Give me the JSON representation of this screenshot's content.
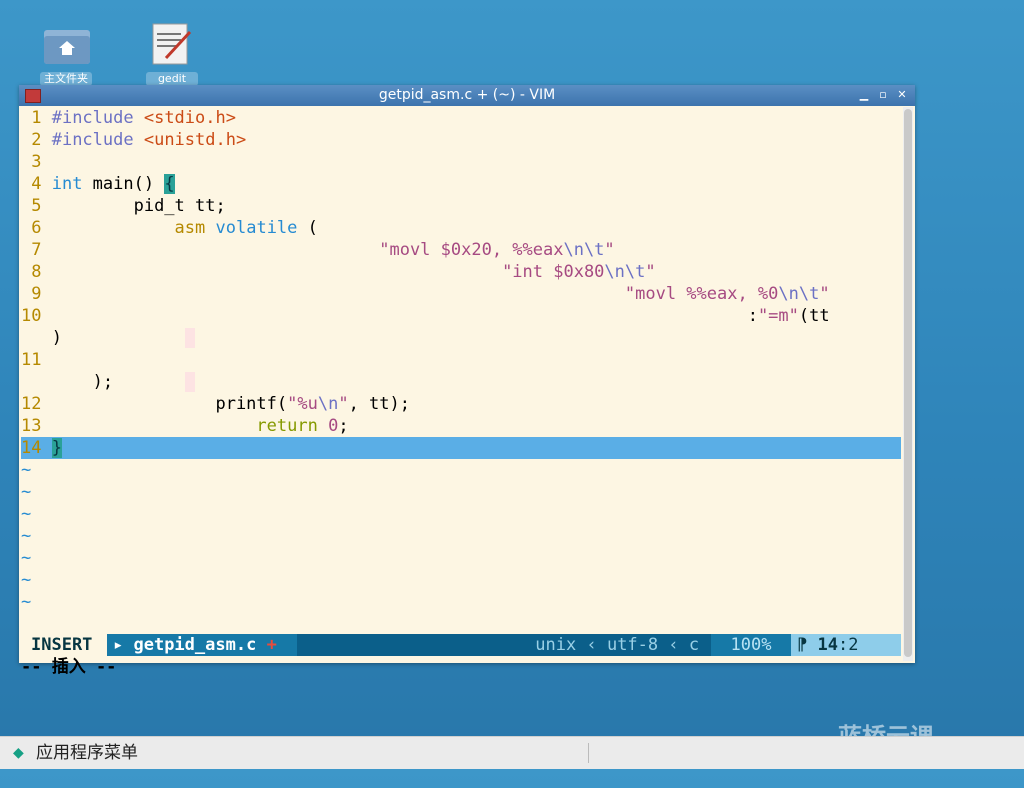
{
  "desktop": {
    "icons": [
      {
        "label": "主文件夹",
        "icon": "home-folder-icon"
      },
      {
        "label": "gedit",
        "icon": "text-editor-icon"
      }
    ],
    "watermark": "蓝桥云课"
  },
  "window": {
    "title": "getpid_asm.c + (~) - VIM",
    "buttons": {
      "minimize": "▁",
      "maximize": "▫",
      "close": "✕"
    }
  },
  "code": {
    "lines": [
      {
        "n": "1",
        "text": "#include <stdio.h>"
      },
      {
        "n": "2",
        "text": "#include <unistd.h>"
      },
      {
        "n": "3",
        "text": ""
      },
      {
        "n": "4",
        "text": "int main() {"
      },
      {
        "n": "5",
        "text": "        pid_t tt;"
      },
      {
        "n": "6",
        "text": "            asm volatile ("
      },
      {
        "n": "7",
        "text": "                                \"movl $0x20, %%eax\\n\\t\""
      },
      {
        "n": "8",
        "text": "                                            \"int $0x80\\n\\t\""
      },
      {
        "n": "9",
        "text": "                                                        \"movl %%eax, %0\\n\\t\""
      },
      {
        "n": "10",
        "text": "                                                                    :\"=m\"(tt"
      },
      {
        "n": "",
        "text": ")"
      },
      {
        "n": "11",
        "text": ""
      },
      {
        "n": "",
        "text": "    );"
      },
      {
        "n": "12",
        "text": "                printf(\"%u\\n\", tt);"
      },
      {
        "n": "13",
        "text": "                    return 0;"
      },
      {
        "n": "14",
        "text": "}"
      }
    ],
    "tilde": "~"
  },
  "statusline": {
    "mode": "INSERT",
    "file": "getpid_asm.c",
    "modified": "+",
    "format": "unix",
    "encoding": "utf-8",
    "filetype": "c",
    "percent": "100%",
    "line": "14",
    "col": "2"
  },
  "cmdline": "-- 插入 --",
  "taskbar": {
    "menu_label": "应用程序菜单"
  }
}
